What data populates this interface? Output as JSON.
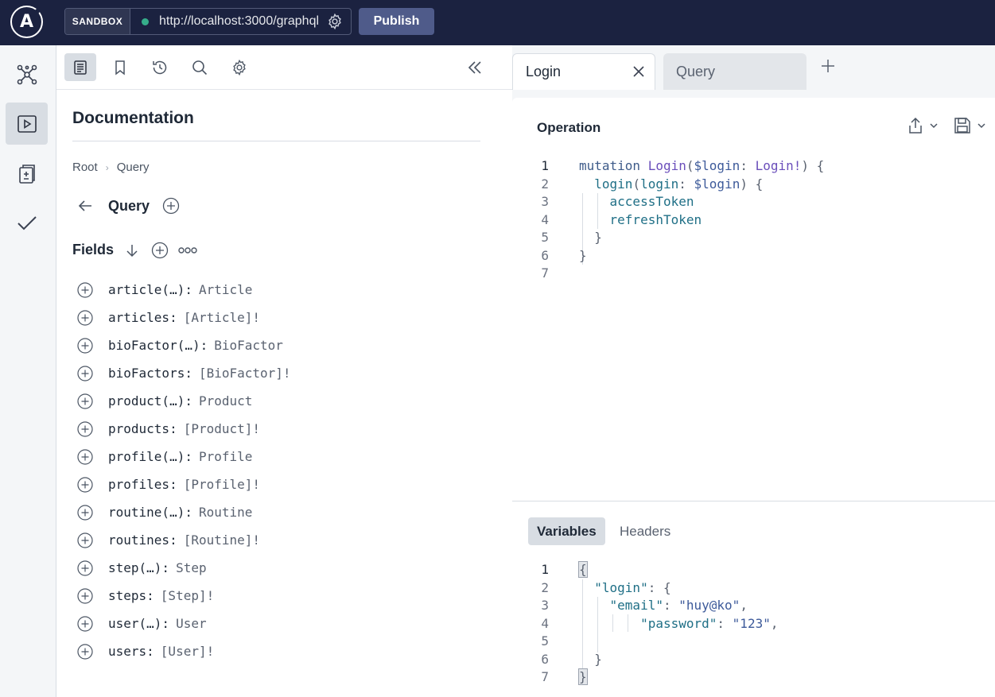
{
  "topbar": {
    "logo_letter": "A",
    "sandbox_label": "SANDBOX",
    "endpoint": "http://localhost:3000/graphql",
    "publish_label": "Publish",
    "status_color": "#36ad8a"
  },
  "leftnav": {
    "items": [
      {
        "icon": "schema-graph-icon",
        "active": false
      },
      {
        "icon": "explorer-play-icon",
        "active": true
      },
      {
        "icon": "diff-checks-icon",
        "active": false
      },
      {
        "icon": "checkmark-icon",
        "active": false
      }
    ]
  },
  "docs": {
    "title": "Documentation",
    "breadcrumb": [
      "Root",
      "Query"
    ],
    "type_name": "Query",
    "fields_label": "Fields",
    "fields": [
      {
        "name": "article(…):",
        "type": "Article"
      },
      {
        "name": "articles:",
        "type": "[Article]!"
      },
      {
        "name": "bioFactor(…):",
        "type": "BioFactor"
      },
      {
        "name": "bioFactors:",
        "type": "[BioFactor]!"
      },
      {
        "name": "product(…):",
        "type": "Product"
      },
      {
        "name": "products:",
        "type": "[Product]!"
      },
      {
        "name": "profile(…):",
        "type": "Profile"
      },
      {
        "name": "profiles:",
        "type": "[Profile]!"
      },
      {
        "name": "routine(…):",
        "type": "Routine"
      },
      {
        "name": "routines:",
        "type": "[Routine]!"
      },
      {
        "name": "step(…):",
        "type": "Step"
      },
      {
        "name": "steps:",
        "type": "[Step]!"
      },
      {
        "name": "user(…):",
        "type": "User"
      },
      {
        "name": "users:",
        "type": "[User]!"
      }
    ]
  },
  "tabs": [
    {
      "label": "Login",
      "active": true
    },
    {
      "label": "Query",
      "active": false
    }
  ],
  "operation": {
    "title": "Operation",
    "line_numbers": [
      "1",
      "2",
      "3",
      "4",
      "5",
      "6",
      "7"
    ],
    "l1": {
      "kw": "mutation",
      "name": "Login",
      "open": "(",
      "var": "$login",
      "colon": ":",
      "type": "Login!",
      "close": ") {"
    },
    "l2": {
      "field": "login",
      "open": "(",
      "arg": "login",
      "colon": ":",
      "var": "$login",
      "close": ") {"
    },
    "l3": "accessToken",
    "l4": "refreshToken",
    "l5": "}",
    "l6": "}"
  },
  "variables": {
    "tab_variables": "Variables",
    "tab_headers": "Headers",
    "line_numbers": [
      "1",
      "2",
      "3",
      "4",
      "5",
      "6",
      "7"
    ],
    "l1": "{",
    "l2_key": "\"login\"",
    "l2_rest": ": {",
    "l3_key": "\"email\"",
    "l3_colon": ":",
    "l3_val": "\"huy@ko\"",
    "l3_comma": ",",
    "l4_key": "\"password\"",
    "l4_colon": ":",
    "l4_val": "\"123\"",
    "l4_comma": ",",
    "l6": "}",
    "l7": "}"
  }
}
